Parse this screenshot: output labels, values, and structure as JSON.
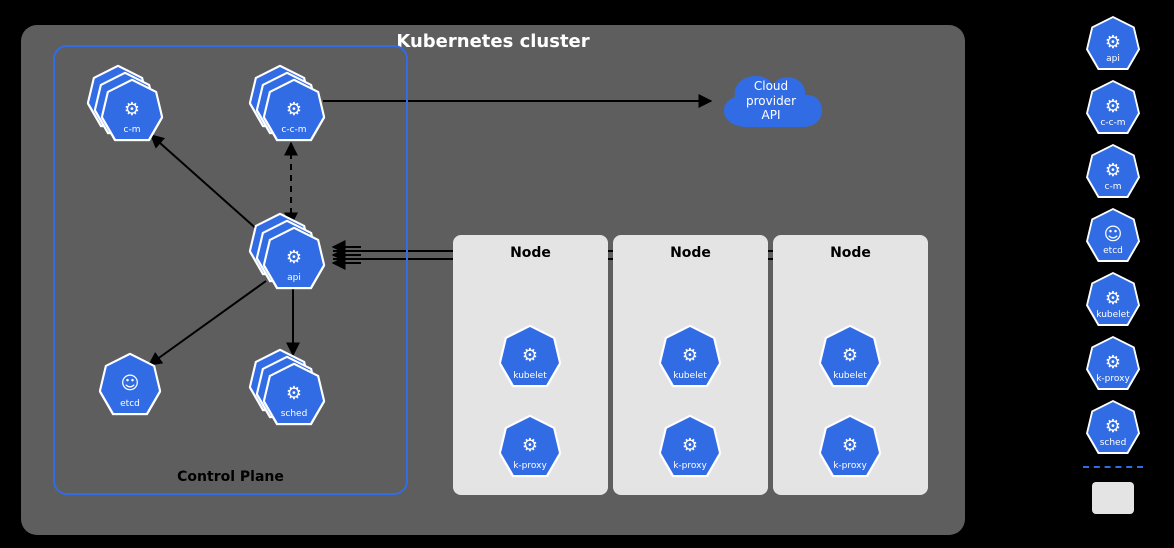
{
  "cluster": {
    "title": "Kubernetes cluster"
  },
  "control_plane": {
    "title": "Control Plane",
    "components": {
      "cm": {
        "label": "c-m",
        "stacked": true,
        "glyph": "⚙"
      },
      "ccm": {
        "label": "c-c-m",
        "stacked": true,
        "glyph": "⚙"
      },
      "api": {
        "label": "api",
        "stacked": true,
        "glyph": "⚙"
      },
      "etcd": {
        "label": "etcd",
        "stacked": false,
        "glyph": "☺"
      },
      "sched": {
        "label": "sched",
        "stacked": true,
        "glyph": "⚙"
      }
    }
  },
  "cloud": {
    "label": "Cloud\nprovider\nAPI"
  },
  "nodes": [
    {
      "title": "Node",
      "kubelet": "kubelet",
      "kproxy": "k-proxy"
    },
    {
      "title": "Node",
      "kubelet": "kubelet",
      "kproxy": "k-proxy"
    },
    {
      "title": "Node",
      "kubelet": "kubelet",
      "kproxy": "k-proxy"
    }
  ],
  "legend": {
    "items": [
      {
        "label": "api",
        "glyph": "⚙"
      },
      {
        "label": "c-c-m",
        "glyph": "⚙"
      },
      {
        "label": "c-m",
        "glyph": "⚙"
      },
      {
        "label": "etcd",
        "glyph": "☺"
      },
      {
        "label": "kubelet",
        "glyph": "⚙"
      },
      {
        "label": "k-proxy",
        "glyph": "⚙"
      },
      {
        "label": "sched",
        "glyph": "⚙"
      }
    ]
  },
  "colors": {
    "k8s_blue": "#326ce5",
    "node_bg": "#e4e4e4",
    "cluster_bg": "#5e5e5e"
  }
}
